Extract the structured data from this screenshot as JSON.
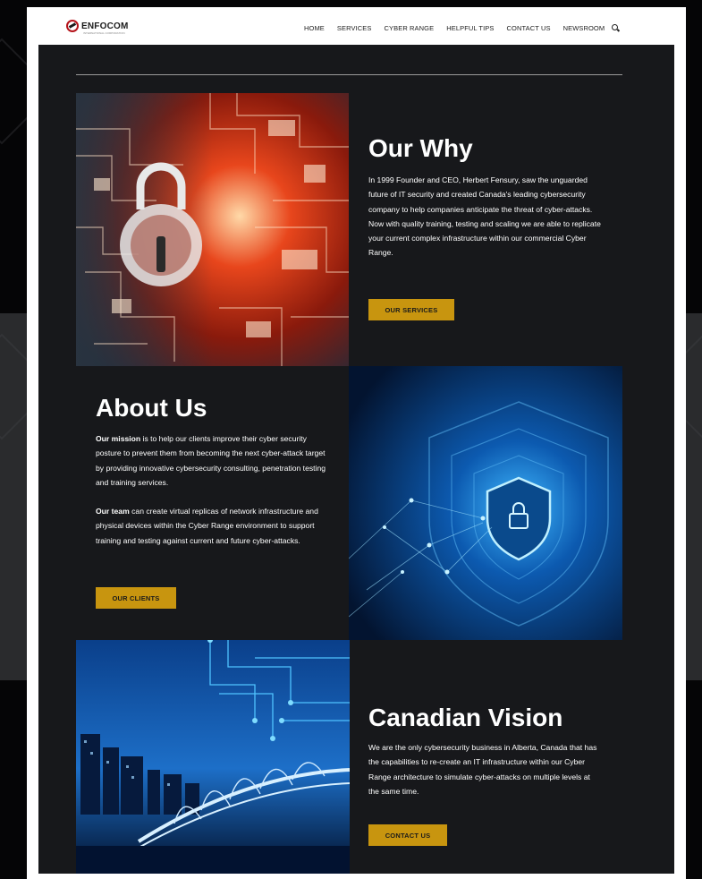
{
  "header": {
    "logo_text": "ENFOCOM",
    "logo_subtitle": "INTERNATIONAL CORPORATION",
    "nav": [
      "HOME",
      "SERVICES",
      "CYBER RANGE",
      "HELPFUL TIPS",
      "CONTACT US",
      "NEWSROOM"
    ]
  },
  "sections": {
    "why": {
      "title": "Our Why",
      "body": "In 1999 Founder and CEO, Herbert Fensury, saw the unguarded future of IT security and created Canada's leading cybersecurity company to help companies anticipate the threat of cyber-attacks.  Now with quality training, testing and scaling we are able to replicate your current complex infrastructure within our commercial Cyber Range.",
      "button": "OUR SERVICES"
    },
    "about": {
      "title": "About Us",
      "mission_lead": "Our mission",
      "mission_body": " is to help our clients improve their cyber security posture to prevent them from becoming the next cyber-attack target by providing innovative cybersecurity consulting, penetration testing and training services.",
      "team_lead": "Our team",
      "team_body": " can create virtual replicas of network infrastructure and physical devices within the Cyber Range environment to support training and testing against current and future cyber-attacks.",
      "button": "OUR CLIENTS"
    },
    "vision": {
      "title": "Canadian Vision",
      "body": "We are the only cybersecurity business in Alberta, Canada that has the capabilities to re-create an IT infrastructure within our Cyber Range architecture to simulate cyber-attacks on multiple levels at the same time.",
      "button": "CONTACT US"
    }
  },
  "colors": {
    "accent": "#c8950f",
    "content_bg": "#17181b",
    "logo_red": "#b5141b"
  },
  "icons": [
    "search-icon"
  ]
}
